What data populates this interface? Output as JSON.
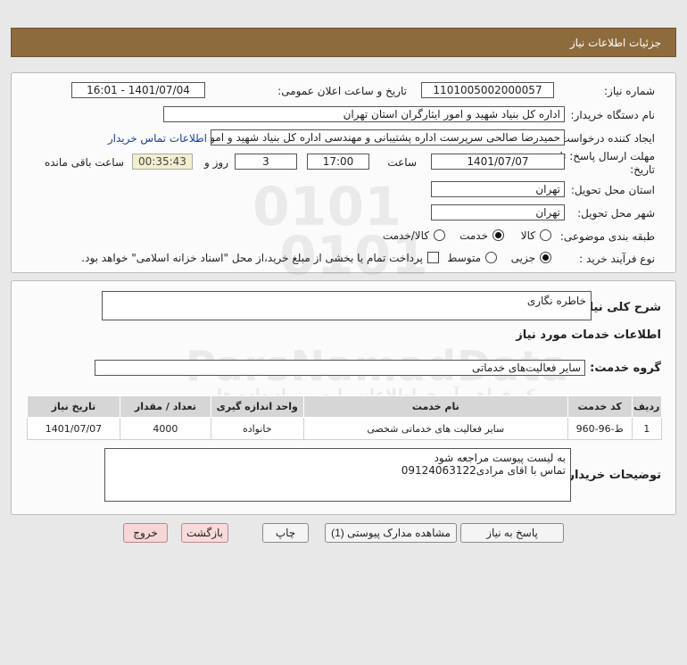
{
  "header": {
    "title": "جزئیات اطلاعات نیاز"
  },
  "need": {
    "number_label": "شماره نیاز:",
    "number_value": "1101005002000057",
    "announce_label": "تاریخ و ساعت اعلان عمومی:",
    "announce_value": "1401/07/04 - 16:01",
    "buyer_label": "نام دستگاه خریدار:",
    "buyer_value": "اداره کل بنیاد شهید و امور ایثارگران استان تهران",
    "creator_label": "ایجاد کننده درخواست:",
    "creator_value": "حمیدرضا صالحی سرپرست اداره پشتیبانی و مهندسی اداره کل بنیاد شهید و امور ایثارگران",
    "contact_link": "اطلاعات تماس خریدار",
    "deadline_label_1": "مهلت ارسال پاسخ: تا",
    "deadline_label_2": "تاریخ:",
    "deadline_date": "1401/07/07",
    "time_label": "ساعت",
    "deadline_time": "17:00",
    "days_value": "3",
    "days_label": "روز و",
    "remaining_value": "00:35:43",
    "remaining_label": "ساعت باقی مانده",
    "province_label": "استان محل تحویل:",
    "province_value": "تهران",
    "city_label": "شهر محل تحویل:",
    "city_value": "تهران",
    "category_label": "طبقه بندی موضوعی:",
    "category_options": [
      "کالا",
      "خدمت",
      "کالا/خدمت"
    ],
    "category_selected": "خدمت",
    "process_label": "نوع فرآیند خرید :",
    "process_options": [
      "جزیی",
      "متوسط"
    ],
    "process_selected": "جزیی",
    "payment_note": "پرداخت تمام یا بخشی از مبلغ خرید،از محل \"اسناد خزانه اسلامی\" خواهد بود."
  },
  "detail": {
    "summary_label": "شرح کلی نیاز:",
    "summary_value": "خاطره نگاری",
    "services_title": "اطلاعات خدمات مورد نیاز",
    "group_label": "گروه خدمت:",
    "group_value": "سایر فعالیت‌های خدماتی",
    "table": {
      "headers": [
        "ردیف",
        "کد خدمت",
        "نام خدمت",
        "واحد اندازه گیری",
        "تعداد / مقدار",
        "تاریخ نیاز"
      ],
      "rows": [
        [
          "1",
          "ط-96-960",
          "سایر فعالیت های خدماتی شخصی",
          "خانواده",
          "4000",
          "1401/07/07"
        ]
      ]
    },
    "buyer_notes_label": "توضیحات خریدار:",
    "buyer_notes_value": "به لیست پیوست مراجعه شود\nتماس با اقای مرادی09124063122"
  },
  "buttons": {
    "reply": "پاسخ به نیاز",
    "docs": "مشاهده مدارک پیوستی (1)",
    "print": "چاپ",
    "back": "بازگشت",
    "exit": "خروج"
  },
  "watermark": {
    "brand": "ParsNamadData",
    "digits": "0101",
    "phone": "021-88349670",
    "slogan_1": "مرکز فراهم آوری اطلاعات پارس نماد داده ها",
    "slogan_2": "پایگاه اطلاع رسانی مناقصه ومزایده"
  }
}
